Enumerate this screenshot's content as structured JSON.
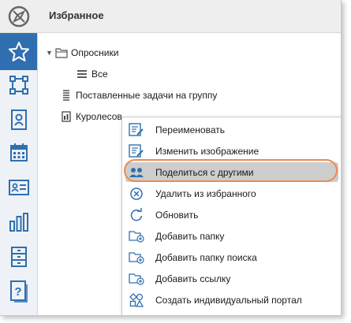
{
  "header": {
    "title": "Избранное",
    "logo_icon": "compass-logo-icon"
  },
  "sidebar": {
    "accent": "#2f6fb0",
    "items": [
      {
        "name": "favorites",
        "icon": "star-icon",
        "active": true
      },
      {
        "name": "workflow",
        "icon": "process-icon"
      },
      {
        "name": "contacts",
        "icon": "contact-book-icon"
      },
      {
        "name": "calendar",
        "icon": "calendar-icon"
      },
      {
        "name": "cards",
        "icon": "id-card-icon"
      },
      {
        "name": "reports",
        "icon": "bar-chart-icon"
      },
      {
        "name": "archive",
        "icon": "cabinet-icon"
      },
      {
        "name": "help",
        "icon": "help-icon"
      }
    ]
  },
  "tree": {
    "items": [
      {
        "label": "Опросники",
        "icon": "folder-icon",
        "expanded": true
      },
      {
        "label": "Все",
        "icon": "list-icon"
      },
      {
        "label": "Поставленные задачи на группу",
        "icon": "task-list-icon"
      },
      {
        "label": "Куролесов",
        "icon": "document-icon"
      }
    ]
  },
  "context_menu": {
    "highlight_color": "#ec8a4f",
    "items": [
      {
        "label": "Переименовать",
        "icon": "rename-icon"
      },
      {
        "label": "Изменить изображение",
        "icon": "edit-image-icon"
      },
      {
        "label": "Поделиться с другими",
        "icon": "share-users-icon",
        "selected": true
      },
      {
        "label": "Удалить из избранного",
        "icon": "remove-circle-icon"
      },
      {
        "label": "Обновить",
        "icon": "refresh-icon"
      },
      {
        "label": "Добавить папку",
        "icon": "add-folder-icon"
      },
      {
        "label": "Добавить папку поиска",
        "icon": "add-search-folder-icon"
      },
      {
        "label": "Добавить ссылку",
        "icon": "add-link-icon"
      },
      {
        "label": "Создать индивидуальный портал",
        "icon": "portal-icon"
      }
    ]
  }
}
